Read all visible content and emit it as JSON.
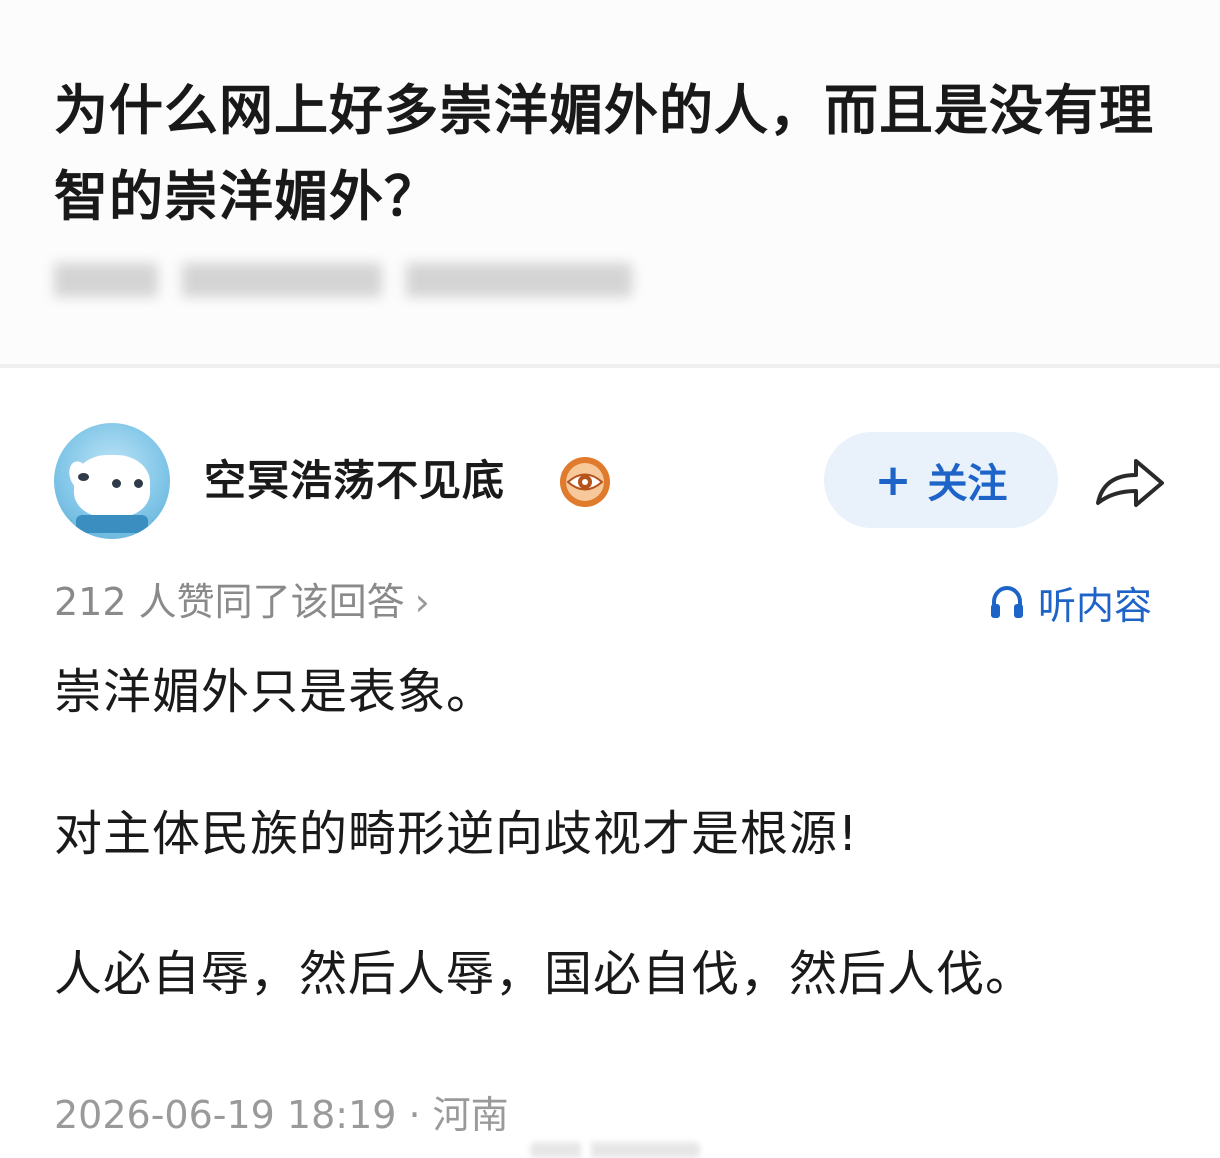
{
  "question": {
    "title": "为什么网上好多崇洋媚外的人，而且是没有理智的崇洋媚外？"
  },
  "author": {
    "name": "空冥浩荡不见底",
    "avatar_icon": "dog-avatar",
    "badge_icon": "eye-badge-icon"
  },
  "actions": {
    "follow_plus": "+",
    "follow_label": "关注",
    "share_icon": "share-arrow-icon"
  },
  "answer": {
    "votes_text": "212 人赞同了该回答",
    "votes_chevron": "›",
    "listen_label": "听内容",
    "paragraphs": [
      "崇洋媚外只是表象。",
      "对主体民族的畸形逆向歧视才是根源!",
      "人必自辱，然后人辱，国必自伐，然后人伐。"
    ],
    "footer": "2026-06-19 18:19 · 河南"
  },
  "colors": {
    "accent": "#1e64c8",
    "follow_bg": "#e9f1fb",
    "muted_text": "#8a8a8a",
    "badge": "#e07a2c"
  }
}
